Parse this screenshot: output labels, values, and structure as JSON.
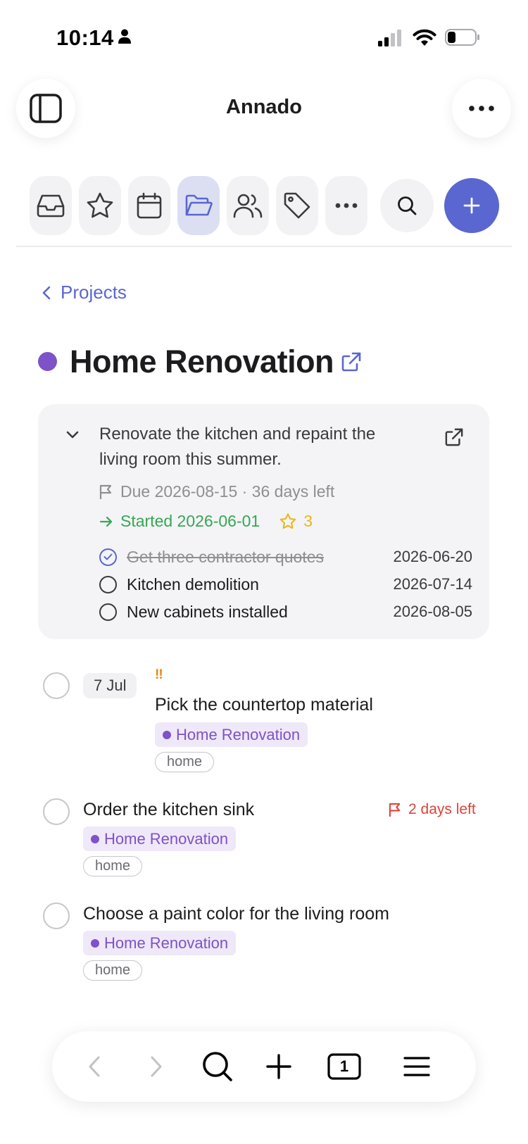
{
  "status_bar": {
    "time": "10:14",
    "icons": [
      "person-icon",
      "cellular-signal-icon",
      "wifi-icon",
      "battery-icon"
    ]
  },
  "header": {
    "title": "Annado",
    "left_icon": "sidebar-toggle-icon",
    "right_icon": "ellipsis-icon"
  },
  "toolbar": {
    "items": [
      {
        "icon": "inbox-icon",
        "active": false
      },
      {
        "icon": "star-icon",
        "active": false
      },
      {
        "icon": "calendar-icon",
        "active": false
      },
      {
        "icon": "folder-open-icon",
        "active": true
      },
      {
        "icon": "people-icon",
        "active": false
      },
      {
        "icon": "tag-icon",
        "active": false
      },
      {
        "icon": "ellipsis-icon",
        "active": false
      }
    ],
    "search_icon": "search-icon",
    "add_icon": "plus-icon"
  },
  "breadcrumb": {
    "label": "Projects"
  },
  "project": {
    "title": "Home Renovation",
    "color": "#7e52c8",
    "description": "Renovate the kitchen and repaint the living room this summer.",
    "due_text": "Due 2026-08-15 · 36 days left",
    "started_text": "Started 2026-06-01",
    "stars": "3",
    "milestones": [
      {
        "title": "Get three contractor quotes",
        "date": "2026-06-20",
        "done": true
      },
      {
        "title": "Kitchen demolition",
        "date": "2026-07-14",
        "done": false
      },
      {
        "title": "New cabinets installed",
        "date": "2026-08-05",
        "done": false
      }
    ]
  },
  "tasks": [
    {
      "date_chip": "7 Jul",
      "priority": "!!",
      "title": "Pick the countertop material",
      "project": "Home Renovation",
      "tag": "home",
      "deadline": ""
    },
    {
      "date_chip": "",
      "priority": "",
      "title": "Order the kitchen sink",
      "project": "Home Renovation",
      "tag": "home",
      "deadline": "2 days left"
    },
    {
      "date_chip": "",
      "priority": "",
      "title": "Choose a paint color for the living room",
      "project": "Home Renovation",
      "tag": "home",
      "deadline": ""
    }
  ],
  "bottom_bar": {
    "tab_count": "1",
    "icons": [
      "back-icon",
      "forward-icon",
      "search-icon",
      "plus-icon",
      "tabs-icon",
      "menu-icon"
    ]
  },
  "colors": {
    "accent": "#5a67d0",
    "project": "#7e52c8",
    "started": "#34a853",
    "star": "#e8b819",
    "priority": "#e8860c",
    "deadline": "#e0433a"
  }
}
